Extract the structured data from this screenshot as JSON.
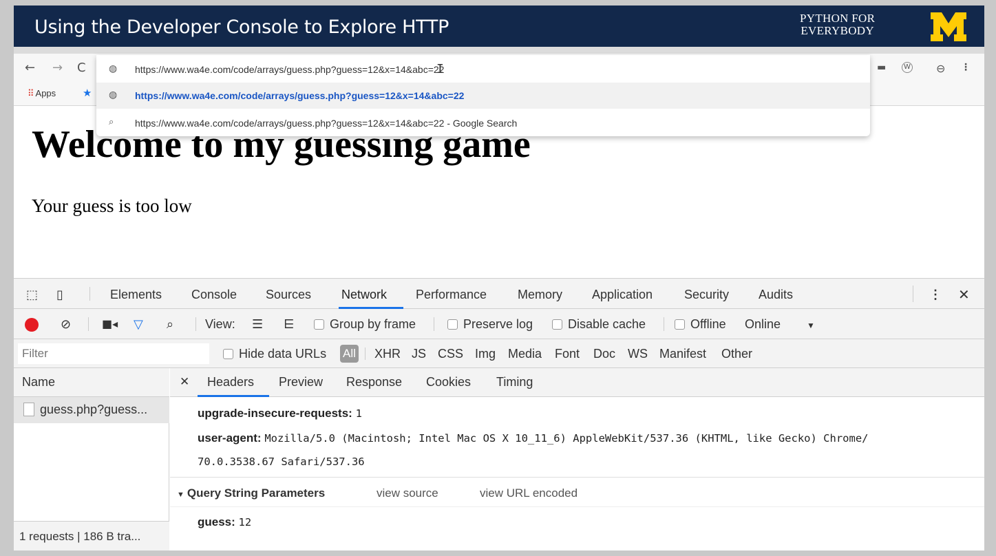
{
  "banner": {
    "title": "Using the Developer Console to Explore HTTP",
    "brand_line1": "PYTHON FOR",
    "brand_line2": "EVERYBODY",
    "logo_letter": "M"
  },
  "browser": {
    "back_icon": "back-arrow-icon",
    "bookmarks_apps": "Apps",
    "omnibox": {
      "input": "https://www.wa4e.com/code/arrays/guess.php?guess=12&x=14&abc=22",
      "suggestion_url": "https://www.wa4e.com/code/arrays/guess.php?guess=12&x=14&abc=22",
      "suggestion_search": "https://www.wa4e.com/code/arrays/guess.php?guess=12&x=14&abc=22 - Google Search"
    }
  },
  "page": {
    "heading": "Welcome to my guessing game",
    "message": "Your guess is too low"
  },
  "devtools": {
    "tabs": [
      "Elements",
      "Console",
      "Sources",
      "Network",
      "Performance",
      "Memory",
      "Application",
      "Security",
      "Audits"
    ],
    "active_tab": "Network",
    "toolbar": {
      "view_label": "View:",
      "group_by_frame": "Group by frame",
      "preserve_log": "Preserve log",
      "disable_cache": "Disable cache",
      "offline": "Offline",
      "throttle": "Online"
    },
    "filter": {
      "placeholder": "Filter",
      "hide_data_urls": "Hide data URLs",
      "types": [
        "All",
        "XHR",
        "JS",
        "CSS",
        "Img",
        "Media",
        "Font",
        "Doc",
        "WS",
        "Manifest",
        "Other"
      ]
    },
    "requests": {
      "header": "Name",
      "items": [
        "guess.php?guess..."
      ],
      "status": "1 requests  |  186 B tra..."
    },
    "details": {
      "tabs": [
        "Headers",
        "Preview",
        "Response",
        "Cookies",
        "Timing"
      ],
      "active_tab": "Headers",
      "headers": [
        {
          "key": "upgrade-insecure-requests:",
          "value": "1"
        },
        {
          "key": "user-agent:",
          "value": "Mozilla/5.0 (Macintosh; Intel Mac OS X 10_11_6) AppleWebKit/537.36 (KHTML, like Gecko) Chrome/",
          "cont": "70.0.3538.67 Safari/537.36"
        }
      ],
      "qsp_title": "Query String Parameters",
      "view_source": "view source",
      "view_url_encoded": "view URL encoded",
      "params": [
        {
          "key": "guess:",
          "value": "12"
        }
      ]
    }
  },
  "colors": {
    "banner_bg": "#12284b",
    "logo_maize": "#ffcb05",
    "record_red": "#e51c23",
    "accent_blue": "#1a73e8"
  }
}
